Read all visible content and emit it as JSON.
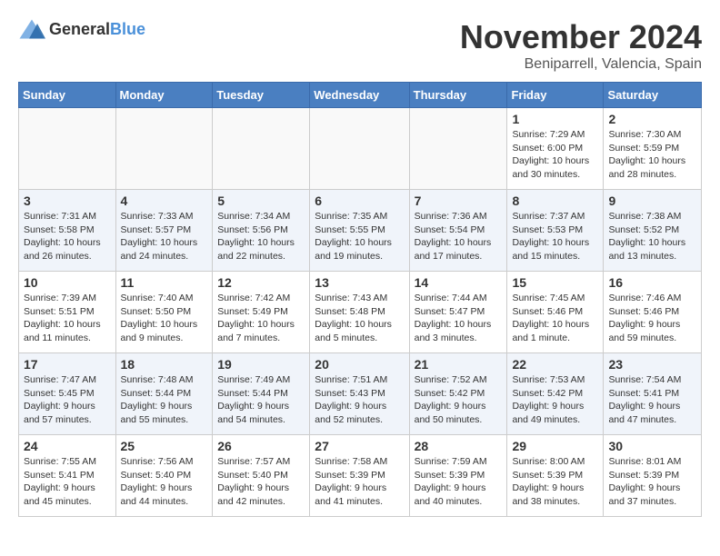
{
  "header": {
    "logo_general": "General",
    "logo_blue": "Blue",
    "month_title": "November 2024",
    "location": "Beniparrell, Valencia, Spain"
  },
  "weekdays": [
    "Sunday",
    "Monday",
    "Tuesday",
    "Wednesday",
    "Thursday",
    "Friday",
    "Saturday"
  ],
  "weeks": [
    [
      {
        "day": "",
        "info": ""
      },
      {
        "day": "",
        "info": ""
      },
      {
        "day": "",
        "info": ""
      },
      {
        "day": "",
        "info": ""
      },
      {
        "day": "",
        "info": ""
      },
      {
        "day": "1",
        "info": "Sunrise: 7:29 AM\nSunset: 6:00 PM\nDaylight: 10 hours and 30 minutes."
      },
      {
        "day": "2",
        "info": "Sunrise: 7:30 AM\nSunset: 5:59 PM\nDaylight: 10 hours and 28 minutes."
      }
    ],
    [
      {
        "day": "3",
        "info": "Sunrise: 7:31 AM\nSunset: 5:58 PM\nDaylight: 10 hours and 26 minutes."
      },
      {
        "day": "4",
        "info": "Sunrise: 7:33 AM\nSunset: 5:57 PM\nDaylight: 10 hours and 24 minutes."
      },
      {
        "day": "5",
        "info": "Sunrise: 7:34 AM\nSunset: 5:56 PM\nDaylight: 10 hours and 22 minutes."
      },
      {
        "day": "6",
        "info": "Sunrise: 7:35 AM\nSunset: 5:55 PM\nDaylight: 10 hours and 19 minutes."
      },
      {
        "day": "7",
        "info": "Sunrise: 7:36 AM\nSunset: 5:54 PM\nDaylight: 10 hours and 17 minutes."
      },
      {
        "day": "8",
        "info": "Sunrise: 7:37 AM\nSunset: 5:53 PM\nDaylight: 10 hours and 15 minutes."
      },
      {
        "day": "9",
        "info": "Sunrise: 7:38 AM\nSunset: 5:52 PM\nDaylight: 10 hours and 13 minutes."
      }
    ],
    [
      {
        "day": "10",
        "info": "Sunrise: 7:39 AM\nSunset: 5:51 PM\nDaylight: 10 hours and 11 minutes."
      },
      {
        "day": "11",
        "info": "Sunrise: 7:40 AM\nSunset: 5:50 PM\nDaylight: 10 hours and 9 minutes."
      },
      {
        "day": "12",
        "info": "Sunrise: 7:42 AM\nSunset: 5:49 PM\nDaylight: 10 hours and 7 minutes."
      },
      {
        "day": "13",
        "info": "Sunrise: 7:43 AM\nSunset: 5:48 PM\nDaylight: 10 hours and 5 minutes."
      },
      {
        "day": "14",
        "info": "Sunrise: 7:44 AM\nSunset: 5:47 PM\nDaylight: 10 hours and 3 minutes."
      },
      {
        "day": "15",
        "info": "Sunrise: 7:45 AM\nSunset: 5:46 PM\nDaylight: 10 hours and 1 minute."
      },
      {
        "day": "16",
        "info": "Sunrise: 7:46 AM\nSunset: 5:46 PM\nDaylight: 9 hours and 59 minutes."
      }
    ],
    [
      {
        "day": "17",
        "info": "Sunrise: 7:47 AM\nSunset: 5:45 PM\nDaylight: 9 hours and 57 minutes."
      },
      {
        "day": "18",
        "info": "Sunrise: 7:48 AM\nSunset: 5:44 PM\nDaylight: 9 hours and 55 minutes."
      },
      {
        "day": "19",
        "info": "Sunrise: 7:49 AM\nSunset: 5:44 PM\nDaylight: 9 hours and 54 minutes."
      },
      {
        "day": "20",
        "info": "Sunrise: 7:51 AM\nSunset: 5:43 PM\nDaylight: 9 hours and 52 minutes."
      },
      {
        "day": "21",
        "info": "Sunrise: 7:52 AM\nSunset: 5:42 PM\nDaylight: 9 hours and 50 minutes."
      },
      {
        "day": "22",
        "info": "Sunrise: 7:53 AM\nSunset: 5:42 PM\nDaylight: 9 hours and 49 minutes."
      },
      {
        "day": "23",
        "info": "Sunrise: 7:54 AM\nSunset: 5:41 PM\nDaylight: 9 hours and 47 minutes."
      }
    ],
    [
      {
        "day": "24",
        "info": "Sunrise: 7:55 AM\nSunset: 5:41 PM\nDaylight: 9 hours and 45 minutes."
      },
      {
        "day": "25",
        "info": "Sunrise: 7:56 AM\nSunset: 5:40 PM\nDaylight: 9 hours and 44 minutes."
      },
      {
        "day": "26",
        "info": "Sunrise: 7:57 AM\nSunset: 5:40 PM\nDaylight: 9 hours and 42 minutes."
      },
      {
        "day": "27",
        "info": "Sunrise: 7:58 AM\nSunset: 5:39 PM\nDaylight: 9 hours and 41 minutes."
      },
      {
        "day": "28",
        "info": "Sunrise: 7:59 AM\nSunset: 5:39 PM\nDaylight: 9 hours and 40 minutes."
      },
      {
        "day": "29",
        "info": "Sunrise: 8:00 AM\nSunset: 5:39 PM\nDaylight: 9 hours and 38 minutes."
      },
      {
        "day": "30",
        "info": "Sunrise: 8:01 AM\nSunset: 5:39 PM\nDaylight: 9 hours and 37 minutes."
      }
    ]
  ]
}
